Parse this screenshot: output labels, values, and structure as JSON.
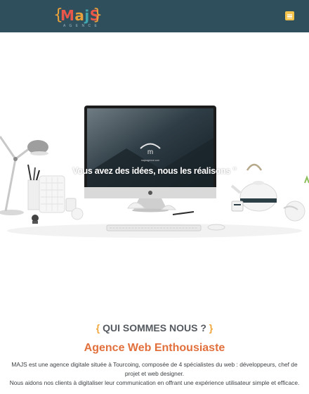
{
  "header": {
    "logo": {
      "brace_open": "{",
      "brace_close": "}",
      "letters": [
        "M",
        "a",
        "j",
        "S"
      ],
      "tagline": "A G E N C E"
    },
    "menu_icon": "hamburger-menu-icon",
    "background": "#2f4f5d"
  },
  "hero": {
    "caption": "Vous avez des idées, nous les réalisons \"",
    "screen_logo": "m",
    "screen_logo_text": "majsagence.com"
  },
  "about": {
    "title_open": "{",
    "title": " QUI SOMMES NOUS ? ",
    "title_close": "}",
    "subtitle": "Agence Web Enthousiaste",
    "paragraph_line1": "MAJS est une agence digitale située à Tourcoing, composée de 4 spécialistes du web : développeurs, chef de projet et web designer.",
    "paragraph_line2": "Nous aidons nos clients à digitaliser leur communication en offrant une expérience utilisateur simple et efficace."
  },
  "colors": {
    "accent_orange": "#e2703d",
    "brace_yellow": "#f0a63a",
    "header_teal": "#2f4f5d"
  }
}
